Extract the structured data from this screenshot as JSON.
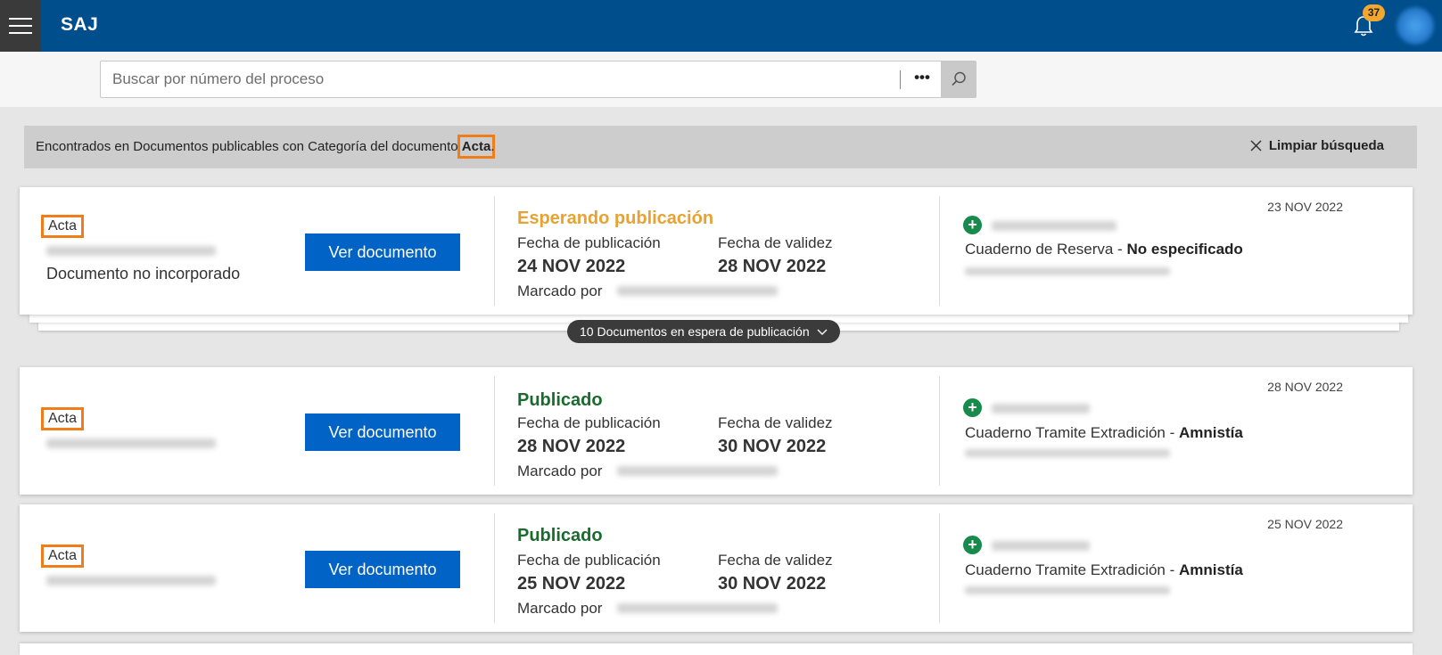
{
  "header": {
    "brand": "SAJ",
    "notifications_count": "37",
    "icons": {
      "menu": "hamburger-icon",
      "bell": "bell-icon"
    }
  },
  "search": {
    "placeholder": "Buscar por número del proceso",
    "value": "",
    "more_label": "•••"
  },
  "filter": {
    "prefix": "Encontrados en Documentos publicables con Categoría del documento ",
    "category": "Acta",
    "suffix": ".",
    "clear_label": "Limpiar búsqueda"
  },
  "labels": {
    "pub_date": "Fecha de publicación",
    "valid_date": "Fecha de validez",
    "marked_by": "Marcado por",
    "view_button": "Ver documento"
  },
  "group_toggle": "10 Documentos en espera de publicación",
  "cards": [
    {
      "tag": "Acta",
      "note": "Documento no incorporado",
      "status": "Esperando publicación",
      "pub_date": "24 NOV 2022",
      "valid_date": "28 NOV 2022",
      "corner_date": "23 NOV 2022",
      "cuaderno": "Cuaderno de Reserva - ",
      "cuaderno_bold": "No especificado"
    },
    {
      "tag": "Acta",
      "note": "",
      "status": "Publicado",
      "pub_date": "28 NOV 2022",
      "valid_date": "30 NOV 2022",
      "corner_date": "28 NOV 2022",
      "cuaderno": "Cuaderno Tramite Extradición - ",
      "cuaderno_bold": "Amnistía"
    },
    {
      "tag": "Acta",
      "note": "",
      "status": "Publicado",
      "pub_date": "25 NOV 2022",
      "valid_date": "30 NOV 2022",
      "corner_date": "25 NOV 2022",
      "cuaderno": "Cuaderno Tramite Extradición - ",
      "cuaderno_bold": "Amnistía"
    }
  ],
  "colors": {
    "header": "#004e8c",
    "primary_button": "#0063c5",
    "waiting": "#e8a232",
    "published": "#1a6b2e",
    "highlight": "#ef7d1a"
  }
}
